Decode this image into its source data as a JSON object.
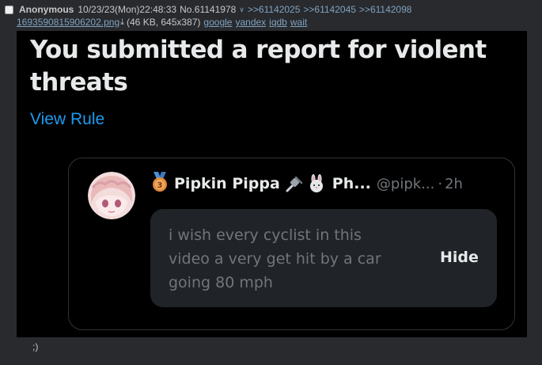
{
  "post": {
    "name": "Anonymous",
    "datetime": "10/23/23(Mon)22:48:33",
    "number": "No.61141978",
    "backlinks": [
      ">>61142025",
      ">>61142045",
      ">>61142098"
    ],
    "file": {
      "filename": "1693590815906202.png",
      "meta": "(46 KB, 645x387)",
      "search_links": [
        "google",
        "yandex",
        "iqdb",
        "wait"
      ]
    },
    "comment": ";)"
  },
  "screenshot": {
    "title": "You submitted a report for violent threats",
    "view_rule": "View Rule",
    "tweet": {
      "display_name": "Pipkin Pippa",
      "emojis": [
        "plug-icon",
        "rabbit-icon"
      ],
      "name_truncated": "Ph...",
      "handle": "@pipk...",
      "dot": "·",
      "time": "2h",
      "hidden_text": "i wish every cyclist in this video a very get hit by a car going 80 mph",
      "hide_label": "Hide"
    },
    "colors": {
      "accent": "#1d9bf0",
      "link": "#81a2be",
      "background": "#282a2e",
      "tweet_bg": "#000000"
    }
  }
}
